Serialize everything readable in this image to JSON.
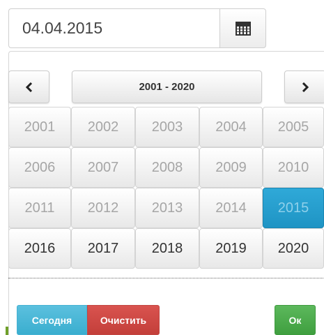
{
  "input": {
    "value": "04.04.2015"
  },
  "calendar_button": {
    "icon": "calendar-icon"
  },
  "nav": {
    "prev_label": "‹",
    "title": "2001 - 2020",
    "next_label": "›"
  },
  "years": [
    [
      "2001",
      "2002",
      "2003",
      "2004",
      "2005"
    ],
    [
      "2006",
      "2007",
      "2008",
      "2009",
      "2010"
    ],
    [
      "2011",
      "2012",
      "2013",
      "2014",
      "2015"
    ],
    [
      "2016",
      "2017",
      "2018",
      "2019",
      "2020"
    ]
  ],
  "selected_year": "2015",
  "buttons": {
    "today": "Сегодня",
    "clear": "Очистить",
    "ok": "Ок"
  },
  "colors": {
    "selected": "#2fa9d8",
    "today": "#5bc0de",
    "clear": "#d9534f",
    "ok": "#5cb85c"
  }
}
